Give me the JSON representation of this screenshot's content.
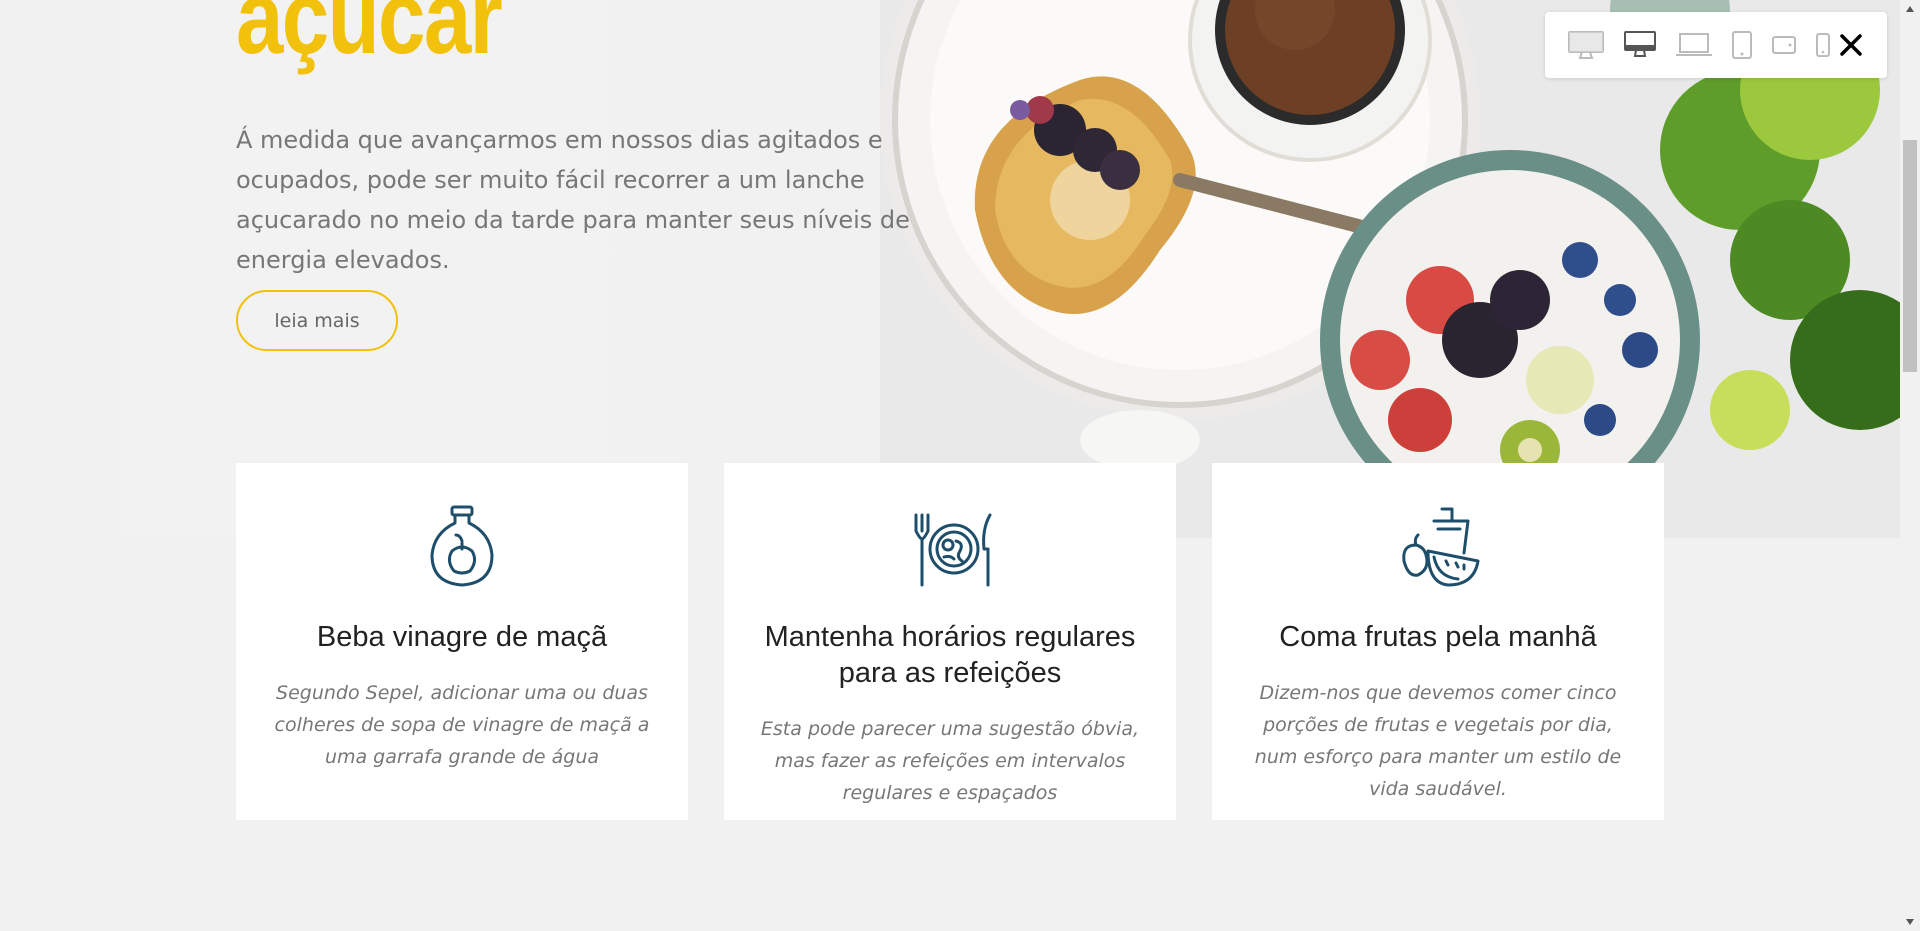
{
  "hero": {
    "title": "açucar",
    "text": "Á medida que avançarmos em nossos dias agitados e ocupados, pode ser muito fácil recorrer a um lanche açucarado no meio da tarde para manter seus níveis de energia elevados.",
    "button_label": "leia mais"
  },
  "cards": [
    {
      "icon": "vinegar-bottle-icon",
      "title": "Beba vinagre de maçã",
      "desc": "Segundo Sepel, adicionar uma ou duas colheres de sopa de vinagre de maçã a uma garrafa grande de água"
    },
    {
      "icon": "plate-cutlery-icon",
      "title": "Mantenha horários regulares para as refeições",
      "desc": "Esta pode parecer uma sugestão óbvia, mas fazer as refeições em intervalos regulares e espaçados"
    },
    {
      "icon": "fruits-drink-icon",
      "title": "Coma frutas pela manhã",
      "desc": "Dizem-nos que devemos comer cinco porções de frutas e vegetais por dia, num esforço para manter um estilo de vida saudável."
    }
  ],
  "toolbar": {
    "icons": [
      "desktop-large-icon",
      "desktop-icon",
      "laptop-icon",
      "tablet-portrait-icon",
      "tablet-landscape-icon",
      "phone-icon"
    ],
    "close": "close-icon"
  },
  "colors": {
    "accent": "#f2c10b",
    "icon": "#1f4e6b",
    "background": "#f1f1f1"
  }
}
